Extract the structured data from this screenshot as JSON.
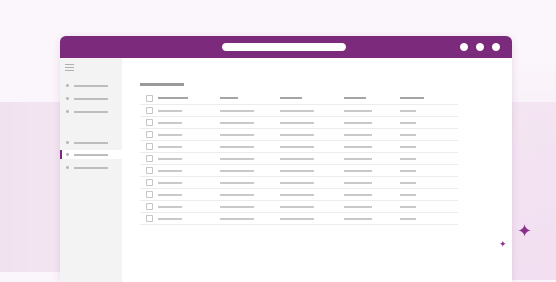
{
  "window": {
    "title_bar_color": "#7b2a7c",
    "window_controls": [
      "control-dot",
      "control-dot",
      "control-dot"
    ]
  },
  "sidebar": {
    "menu_icon": "hamburger-icon",
    "items": [
      {
        "icon": "bullet",
        "active": false
      },
      {
        "icon": "bullet",
        "active": false
      },
      {
        "icon": "bullet",
        "active": false
      },
      {
        "icon": "bullet",
        "active": false
      },
      {
        "icon": "bullet",
        "active": true
      },
      {
        "icon": "bullet",
        "active": false
      }
    ]
  },
  "table": {
    "columns": 5,
    "rows": 10,
    "has_checkboxes": true
  },
  "decorations": {
    "sparkle_large": "✦",
    "sparkle_small": "✦",
    "accent_color": "#8a2f8a"
  }
}
